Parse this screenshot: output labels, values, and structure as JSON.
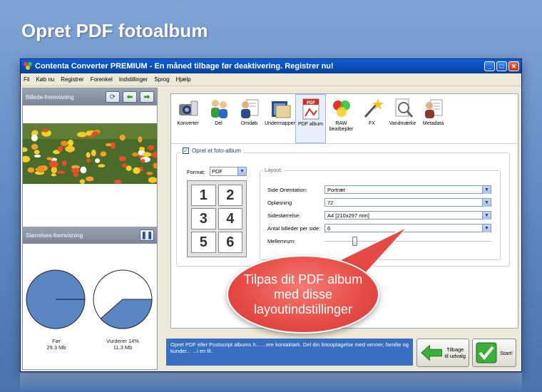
{
  "banner": {
    "title": "Opret PDF fotoalbum"
  },
  "window": {
    "title": "Contenta Converter PREMIUM  - En måned tilbage før deaktivering. Registrer nu!",
    "controls": [
      "minimize",
      "maximize",
      "close"
    ]
  },
  "menu": [
    "Fil",
    "Køb nu",
    "Registrer",
    "Forenkel",
    "Indstillinger",
    "Sprog",
    "Hjælp"
  ],
  "left_panel": {
    "preview_title": "Billede-fremvisning",
    "sizes_title": "Størrelses-fremvisning",
    "before_label": "Før",
    "before_size": "29.3 Mb",
    "after_label": "Vurderer 14%",
    "after_size": "11.3 Mb",
    "pause_icon": "pause-icon"
  },
  "toolbar": [
    {
      "label": "Konverter",
      "icon": "camera-icon"
    },
    {
      "label": "Del",
      "icon": "people-icon"
    },
    {
      "label": "Omdøb",
      "icon": "rename-icon"
    },
    {
      "label": "Undermapper",
      "icon": "folder-icon"
    },
    {
      "label": "PDF album",
      "icon": "pdf-icon"
    },
    {
      "label": "RAW\nbearbejder",
      "icon": "raw-icon"
    },
    {
      "label": "FX",
      "icon": "fx-icon"
    },
    {
      "label": "Vandmærke",
      "icon": "watermark-icon"
    },
    {
      "label": "Metadata",
      "icon": "metadata-icon"
    }
  ],
  "album": {
    "checkbox_label": "Opret et foto-album",
    "checked": true,
    "format_label": "Format:",
    "format_value": "PDF",
    "grid_numbers": [
      "1",
      "2",
      "3",
      "4",
      "5",
      "6"
    ],
    "layout_title": "Layout:",
    "fields": [
      {
        "label": "Side Orientation:",
        "value": "Portræt"
      },
      {
        "label": "Opløsning",
        "value": "72"
      },
      {
        "label": "Sidestørrelse:",
        "value": "A4 [210x297 mm]"
      },
      {
        "label": "Antal billeder per side:",
        "value": "6"
      }
    ],
    "spacing_label": "Mellemrum:",
    "spacing_level": 0.18
  },
  "info_text": "Opret PDF eller Postscript albums h... ...ere kontaktark. Del din fotooptagelse med venner, familie og kunder... ...i en fil.",
  "buttons": {
    "back_label": "Tilbage\ntil udvalg",
    "start_label": "Start!"
  },
  "callout": {
    "text": "Tilpas dit PDF album med disse layoutindstillinger"
  },
  "colors": {
    "accent": "#3a6ec0",
    "callout": "#e64a44",
    "titlebar": "#0a4fb9"
  }
}
